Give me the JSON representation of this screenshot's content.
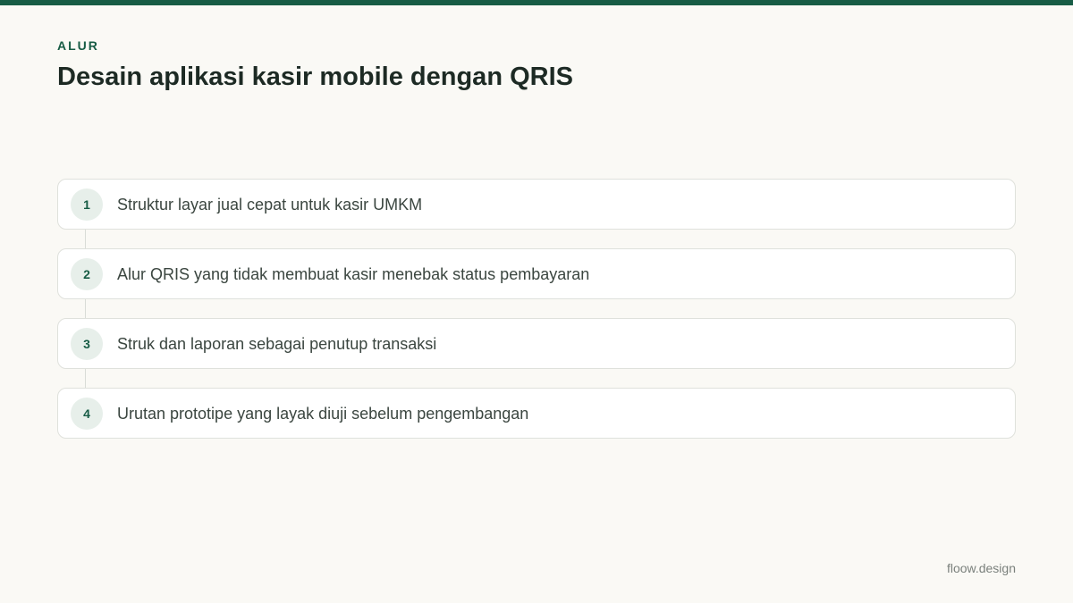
{
  "header": {
    "eyebrow": "ALUR",
    "title": "Desain aplikasi kasir mobile dengan QRIS"
  },
  "steps": [
    {
      "number": "1",
      "label": "Struktur layar jual cepat untuk kasir UMKM"
    },
    {
      "number": "2",
      "label": "Alur QRIS yang tidak membuat kasir menebak status pembayaran"
    },
    {
      "number": "3",
      "label": "Struk dan laporan sebagai penutup transaksi"
    },
    {
      "number": "4",
      "label": "Urutan prototipe yang layak diuji sebelum pengembangan"
    }
  ],
  "footer": {
    "brand": "floow.design"
  },
  "colors": {
    "accent": "#175c45",
    "background": "#faf9f5",
    "badge_bg": "#e7efea"
  }
}
